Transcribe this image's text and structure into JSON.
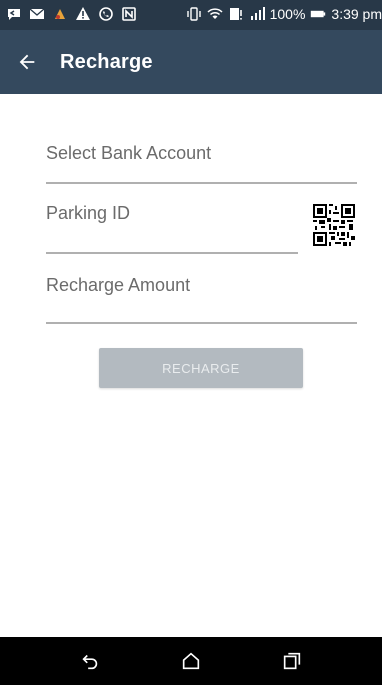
{
  "status_bar": {
    "icons_left": [
      "message-icon",
      "mail-icon",
      "app-icon",
      "warning-icon",
      "nfc-call-icon",
      "nfc-icon"
    ],
    "icons_right": [
      "vibrate-icon",
      "wifi-icon",
      "download-icon",
      "signal-icon",
      "battery-icon"
    ],
    "battery_percent": "100%",
    "time": "3:39 pm"
  },
  "app_bar": {
    "title": "Recharge",
    "back_icon": "arrow-left-icon",
    "background": "#34495e"
  },
  "form": {
    "bank_account_label": "Select Bank Account",
    "parking_id_label": "Parking ID",
    "recharge_amount_label": "Recharge Amount",
    "qr_icon": "qr-code-icon",
    "submit_label": "RECHARGE",
    "submit_state": "disabled"
  },
  "nav_bar": {
    "back_icon": "back-icon",
    "home_icon": "home-icon",
    "recents_icon": "recents-icon"
  }
}
